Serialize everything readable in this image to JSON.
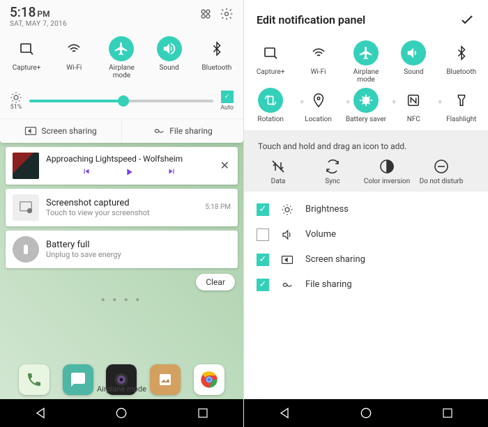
{
  "left": {
    "time": "5:18",
    "ampm": "PM",
    "date": "SAT, MAY 7, 2016",
    "qs": [
      {
        "label": "Capture+",
        "on": false
      },
      {
        "label": "Wi-Fi",
        "on": false
      },
      {
        "label": "Airplane mode",
        "on": true
      },
      {
        "label": "Sound",
        "on": true
      },
      {
        "label": "Bluetooth",
        "on": false
      }
    ],
    "brightness": {
      "pct": "51%",
      "auto": "Auto"
    },
    "share": {
      "screen": "Screen sharing",
      "file": "File sharing"
    },
    "nowplaying": {
      "title": "Approaching Lightspeed - Wolfsheim"
    },
    "notifs": [
      {
        "title": "Screenshot captured",
        "sub": "Touch to view your screenshot",
        "time": "5:18 PM"
      },
      {
        "title": "Battery full",
        "sub": "Unplug to save energy"
      }
    ],
    "clear": "Clear",
    "dock_label": "Airplane mode"
  },
  "right": {
    "title": "Edit notification panel",
    "row1": [
      {
        "label": "Capture+",
        "on": false
      },
      {
        "label": "Wi-Fi",
        "on": false
      },
      {
        "label": "Airplane mode",
        "on": true
      },
      {
        "label": "Sound",
        "on": true
      },
      {
        "label": "Bluetooth",
        "on": false
      }
    ],
    "row2": [
      {
        "label": "Rotation",
        "on": true
      },
      {
        "label": "Location",
        "on": false
      },
      {
        "label": "Battery saver",
        "on": true
      },
      {
        "label": "NFC",
        "on": false
      },
      {
        "label": "Flashlight",
        "on": false
      }
    ],
    "hint": "Touch and hold and drag an icon to add.",
    "hint_items": [
      {
        "label": "Data"
      },
      {
        "label": "Sync"
      },
      {
        "label": "Color inversion"
      },
      {
        "label": "Do not disturb"
      }
    ],
    "checks": [
      {
        "label": "Brightness",
        "on": true
      },
      {
        "label": "Volume",
        "on": false
      },
      {
        "label": "Screen sharing",
        "on": true
      },
      {
        "label": "File sharing",
        "on": true
      }
    ]
  }
}
